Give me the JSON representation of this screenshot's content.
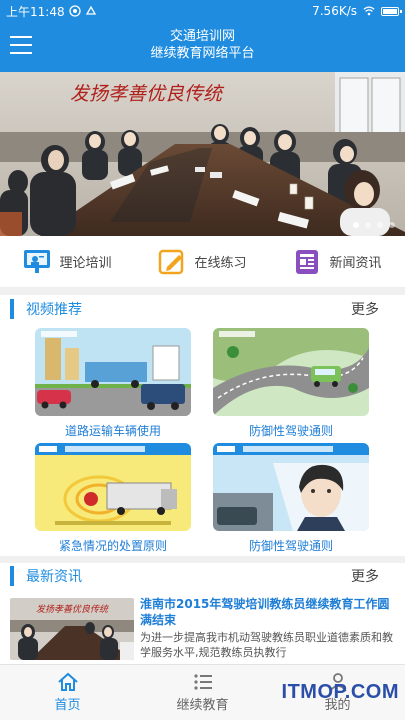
{
  "status_bar": {
    "time": "上午11:48",
    "speed": "7.56K/s"
  },
  "header": {
    "title_line1": "交通培训网",
    "title_line2": "继续教育网络平台"
  },
  "banner": {
    "wall_text": "发扬孝善优良传统",
    "slide_count": 4,
    "active_slide": 1
  },
  "quick_nav": [
    {
      "label": "理论培训",
      "icon": "teacher-icon"
    },
    {
      "label": "在线练习",
      "icon": "pencil-icon"
    },
    {
      "label": "新闻资讯",
      "icon": "newspaper-icon"
    }
  ],
  "videos_section": {
    "title": "视频推荐",
    "more": "更多",
    "items": [
      {
        "title": "道路运输车辆使用"
      },
      {
        "title": "防御性驾驶通则"
      },
      {
        "title": "紧急情况的处置原则"
      },
      {
        "title": "防御性驾驶通则"
      }
    ]
  },
  "news_section": {
    "title": "最新资讯",
    "more": "更多",
    "items": [
      {
        "title": "淮南市2015年驾驶培训教练员继续教育工作圆满结束",
        "summary": "为进一步提高我市机动驾驶教练员职业道德素质和教学服务水平,规范教练员执教行"
      }
    ]
  },
  "tab_bar": [
    {
      "label": "首页",
      "icon": "home-icon",
      "active": true
    },
    {
      "label": "继续教育",
      "icon": "list-icon",
      "active": false
    },
    {
      "label": "我的",
      "icon": "user-icon",
      "active": false
    }
  ],
  "watermark": "ITMOP.COM",
  "colors": {
    "primary": "#1f8ce0",
    "link": "#1f7ed6"
  }
}
